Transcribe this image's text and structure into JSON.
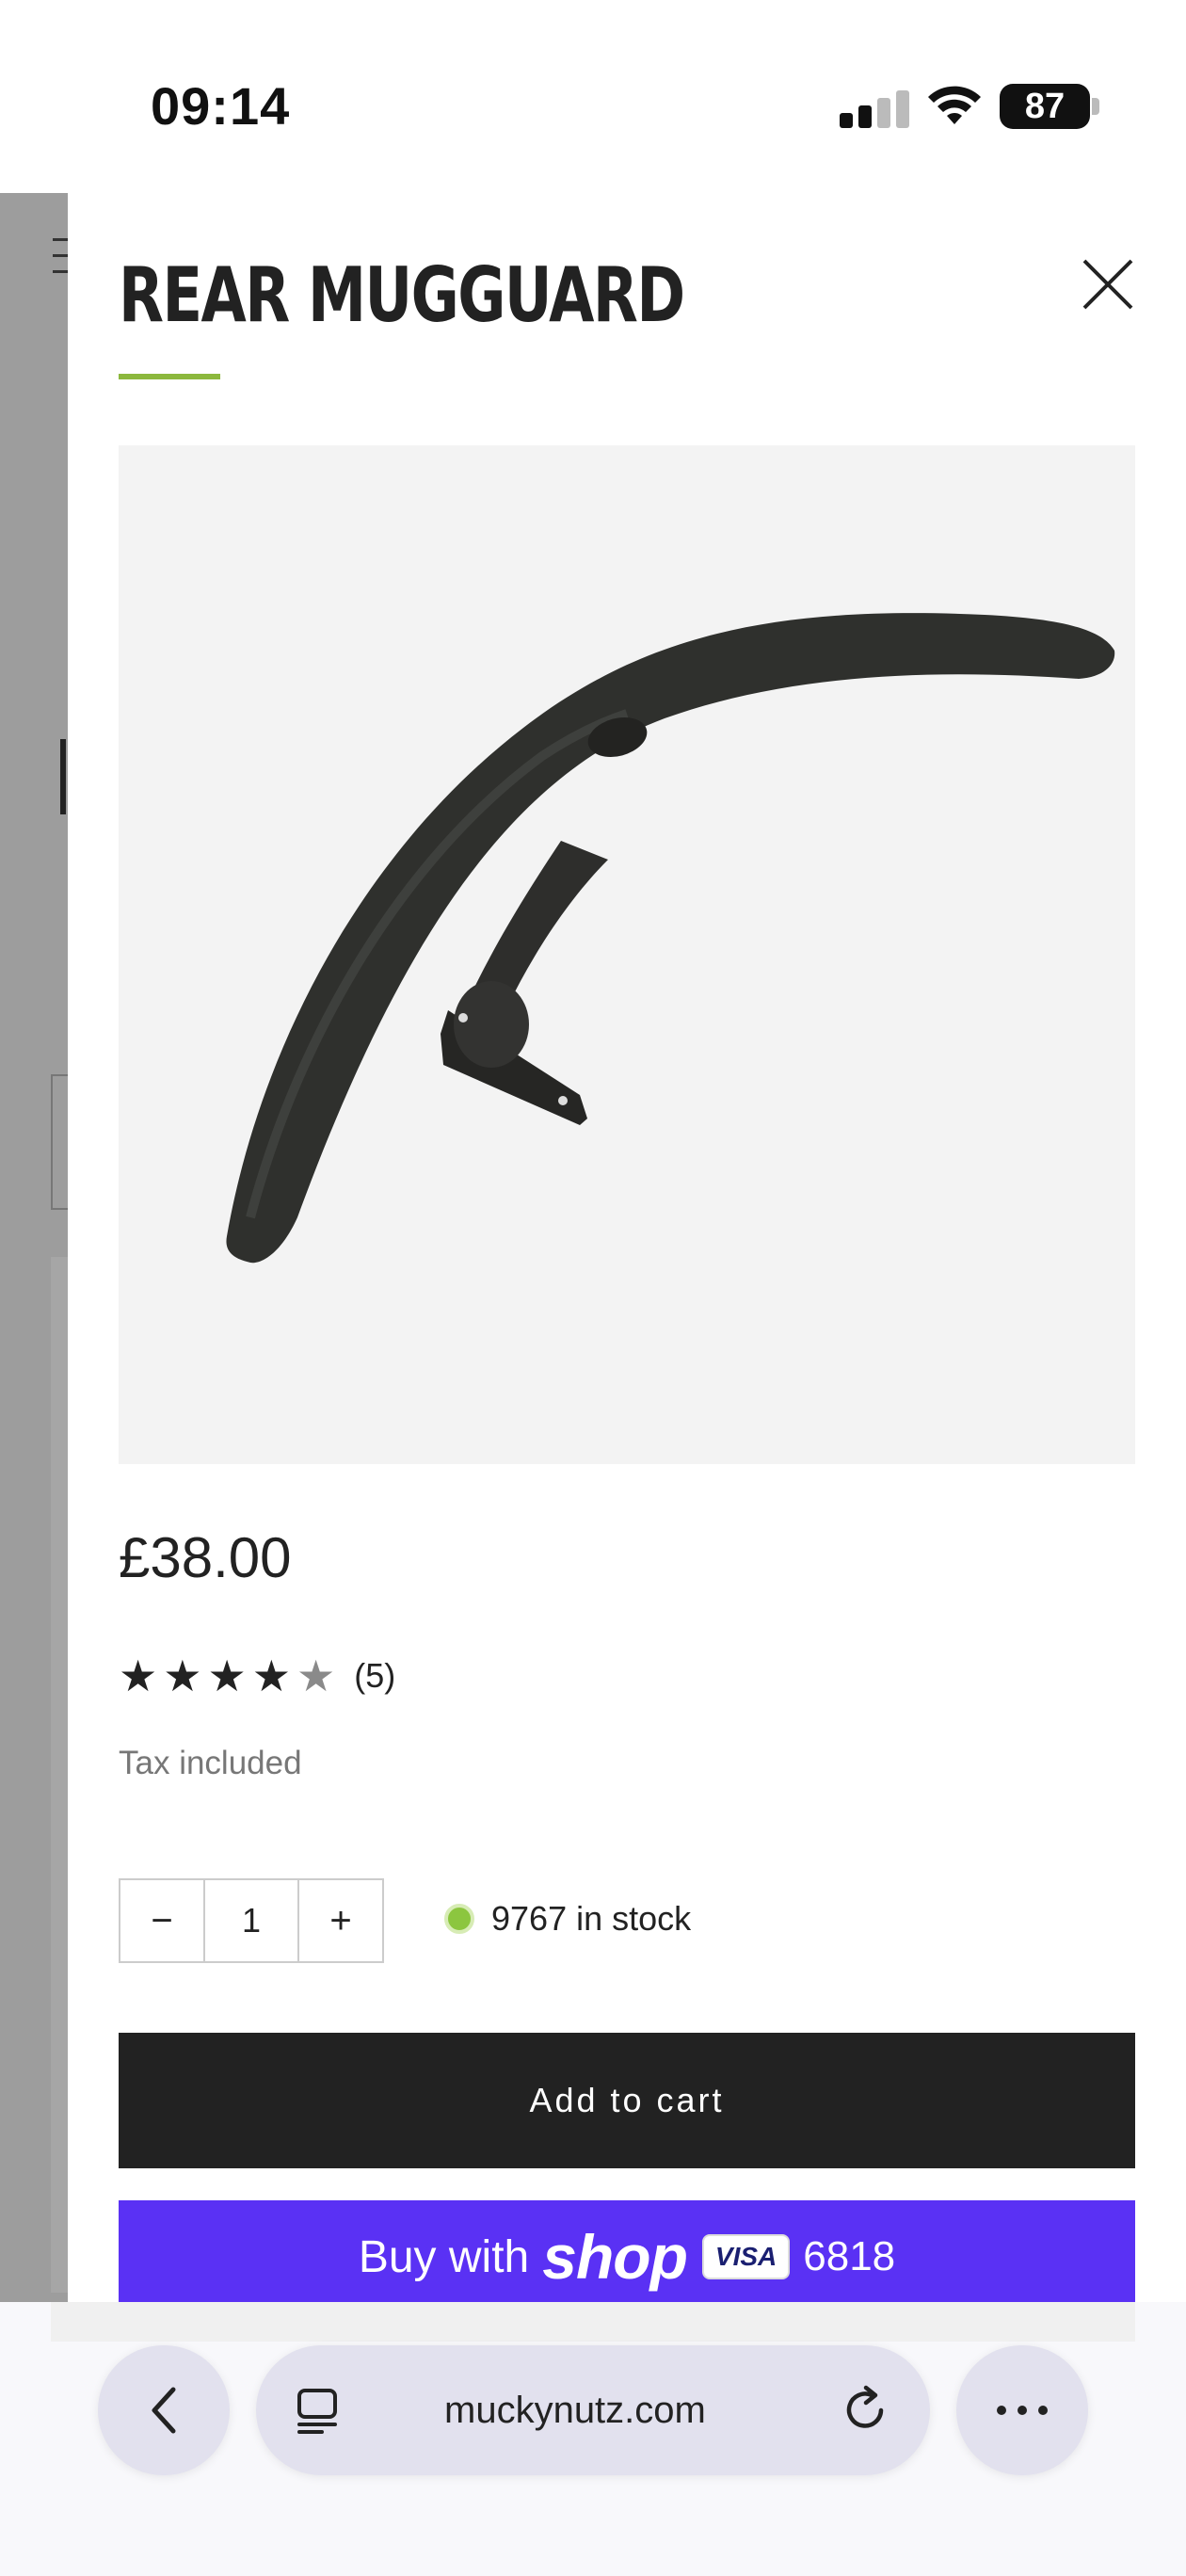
{
  "status_bar": {
    "time": "09:14",
    "battery": "87"
  },
  "product": {
    "title": "REAR MUGGUARD",
    "image_alt": "Rear Mugguard",
    "price": "£38.00",
    "rating": {
      "stars": 4,
      "max": 5,
      "count_label": "(5)"
    },
    "tax_note": "Tax included",
    "quantity": "1",
    "decrease_label": "−",
    "increase_label": "+",
    "stock_text": "9767 in stock"
  },
  "buttons": {
    "add_to_cart": "Add to cart",
    "buy_with": "Buy with",
    "shop_logo": "shop",
    "card_brand": "VISA",
    "card_digits": "6818"
  },
  "browser": {
    "url": "muckynutz.com"
  },
  "colors": {
    "accent_green": "#8cb83d",
    "stock_green": "#8cc63f",
    "shop_pay_purple": "#5a31f4",
    "button_dark": "#222222"
  },
  "icons": [
    "close-icon",
    "star-icon",
    "back-chevron-icon",
    "tabs-icon",
    "reload-icon",
    "more-icon",
    "wifi-icon",
    "signal-icon",
    "battery-icon"
  ]
}
